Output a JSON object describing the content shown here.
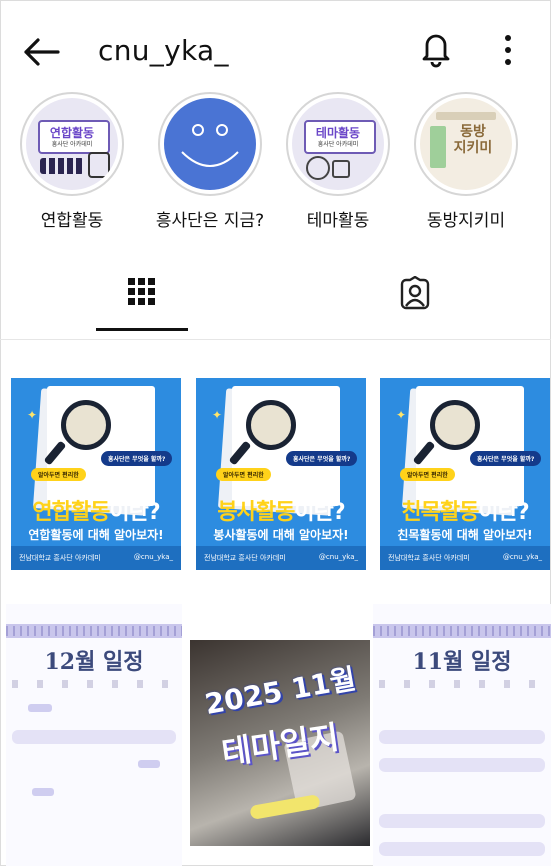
{
  "header": {
    "username": "cnu_yka_"
  },
  "highlights": [
    {
      "label": "연합활동",
      "cover_title": "연합활동",
      "cover_sub": "흥사단 아카데미"
    },
    {
      "label": "흥사단은 지금?"
    },
    {
      "label": "테마활동",
      "cover_title": "테마활동",
      "cover_sub": "흥사단 아카데미"
    },
    {
      "label": "동방지키미",
      "cover_title": "동방\n지키미"
    }
  ],
  "posts": [
    {
      "title_hi": "연합활동",
      "title_rest": "이란?",
      "pill_a": "알아두면 편리한",
      "pill_b": "흥사단은 무엇을 할까?",
      "subtitle": "연합활동에 대해 알아보자!",
      "footer_left": "전남대학교 흥사단 아카데미",
      "footer_right": "@cnu_yka_"
    },
    {
      "title_hi": "봉사활동",
      "title_rest": "이란?",
      "pill_a": "알아두면 편리한",
      "pill_b": "흥사단은 무엇을 할까?",
      "subtitle": "봉사활동에 대해 알아보자!",
      "footer_left": "전남대학교 흥사단 아카데미",
      "footer_right": "@cnu_yka_"
    },
    {
      "title_hi": "친목활동",
      "title_rest": "이란?",
      "pill_a": "알아두면 편리한",
      "pill_b": "흥사단은 무엇을 할까?",
      "subtitle": "친목활동에 대해 알아보자!",
      "footer_left": "전남대학교 흥사단 아카데미",
      "footer_right": "@cnu_yka_"
    },
    {
      "calendar_title": "12월 일정"
    },
    {
      "photo_title_line1": "2025 11월",
      "photo_title_line2": "테마일지"
    },
    {
      "calendar_title": "11월 일정"
    }
  ],
  "colors": {
    "card_blue": "#2d8ce0",
    "highlight_yellow": "#ffd21a",
    "calendar_accent": "#c9c6ec"
  }
}
